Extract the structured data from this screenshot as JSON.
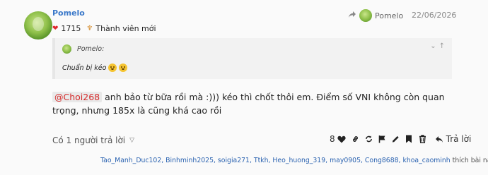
{
  "post": {
    "author": "Pomelo",
    "likes_count": "1715",
    "rank": "Thành viên mới",
    "reply_to_user": "Pomelo",
    "date": "22/06/2026",
    "quote": {
      "author": "Pomelo:",
      "text": "Chuẩn bị kéo"
    },
    "mention": "@Choi268",
    "body_text": " anh bảo từ bữa rồi mà :))) kéo thì chốt thôi em. Điểm số VNI không còn quan trọng, nhưng 185x là cũng khá cao rồi",
    "replies_label": "Có 1 người trả lời",
    "like_count": "8",
    "reply_label": "Trả lời",
    "likers": [
      "Tao_Manh_Duc102",
      "Binhminh2025",
      "soigia271",
      "Ttkh",
      "Heo_huong_319",
      "may0905",
      "Cong8688",
      "khoa_caominh"
    ],
    "likers_suffix": "thích bài này"
  },
  "colors": {
    "username": "#3a78c9",
    "mention": "#d52b2b",
    "heart": "#e0282e",
    "link": "#2a62b0"
  },
  "icons": [
    "heart-icon",
    "trophy-icon",
    "share-icon",
    "chevron-down-icon",
    "chevron-up-icon",
    "link-icon",
    "repost-icon",
    "flag-icon",
    "edit-icon",
    "bookmark-icon",
    "delete-icon",
    "reply-icon"
  ]
}
